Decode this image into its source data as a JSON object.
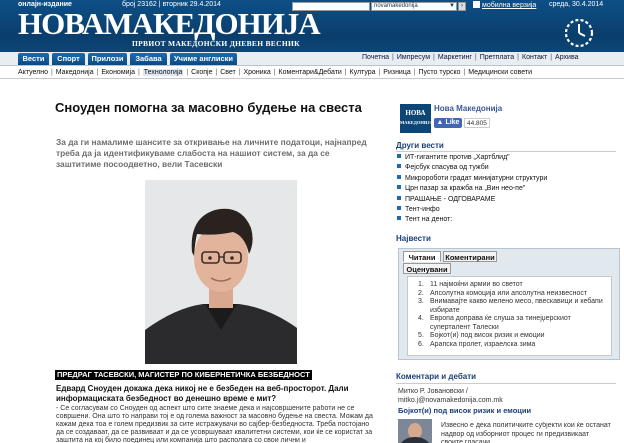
{
  "header": {
    "online_label": "онлајн-издание",
    "issue_info": "број 23162 | вторник 29.4.2014",
    "logo": "НОВАМАКЕДОНИЈА",
    "tagline": "ПРВИОТ МАКЕДОНСКИ ДНЕВЕН ВЕСНИК",
    "search_scope": "novamakedonija",
    "mobile_link": "мобилна верзија",
    "date": "среда, 30.4.2014"
  },
  "nav": {
    "tabs": [
      "Вести",
      "Спорт",
      "Прилози",
      "Забава",
      "Учиме англиски"
    ],
    "links": [
      "Почетна",
      "Импресум",
      "Маркетинг",
      "Претплата",
      "Контакт",
      "Архива"
    ]
  },
  "subnav": {
    "items": [
      "Актуелно",
      "Македонија",
      "Економија",
      "Технологија",
      "Скопје",
      "Свет",
      "Хроника",
      "Коментари&Дебати",
      "Култура",
      "Ризница",
      "Пусто турско",
      "Медицински совети"
    ],
    "active": "Технологија"
  },
  "article": {
    "title": "Сноуден помогна за масовно будење на свеста",
    "lead": "За да ги намалиме шансите за откривање на личните податоци, најнапред треба да ја идентификуваме слабоста на нашиот систем, за да се заштитиме посоодветно, вели Тасевски",
    "caption": "ПРЕДРАГ ТАСЕВСКИ, МАГИСТЕР ПО КИБЕРНЕТИЧКА БЕЗБЕДНОСТ",
    "subhead": "Едвард Сноуден докажа дека никој не е безбеден на веб-просторот. Дали информациската безбедност во денешно време е мит?",
    "body": "- Се согласувам со Сноуден од аспект што сите знаеме дека и најсовршените работи не се совршени. Она што то направи тој е од голема важност за масовно будење на свеста. Можам да кажам дека тоа е голем предизвик за сите истражувачи во сајбер-безбедноста. Треба постојано да се создаваат, да се развиваат и да се усовршуваат квалитетни системи, кои ќе се користат за заштита на кој било поединец или компанија што располага со свои лични и"
  },
  "sidebar": {
    "fb_logo_line1": "НОВА",
    "fb_logo_line2": "МАКЕДОНИЈА",
    "fb_name": "Нова Македонија",
    "fb_like": "Like",
    "fb_count": "44.805",
    "other_news_title": "Други вести",
    "other_news": [
      "ИТ-гигантите против „Хартблид\"",
      "Фејсбук спасува од тужби",
      "Микророботи градат минијатурни структури",
      "Црн пазар за кражба на „Вин нео-пе\"",
      "ПРАШАЊЕ - ОДГОВАРАМЕ",
      "Тент-инфо",
      "Тент на денот:"
    ],
    "latest_title": "Највести",
    "tabs": [
      "Читани",
      "Коментирани",
      "Оценувани"
    ],
    "popular": [
      "11 најмоќни армии во светот",
      "Апсолутна комоција или апсолутна неизвесност",
      "Внимавајте какво мелено месо, пвескавици и кебапи избирате",
      "Европа доправа ќе слуша за тинејџерскиот суперталент Талески",
      "Бојкот(и) под висок ризик и емоции",
      "Арапска пролет, израелска зима"
    ],
    "comments_title": "Коментари и дебати",
    "comment_author": "Митко Р. Јовановски /",
    "comment_email": "mitko.j@novamakedonija.com.mk",
    "comment_title": "Бојкот(и) под висок ризик и емоции",
    "comment_text": "Извесно е дека политичките субјекти кои ќе останат надвор од изборниот процес ги предизвикаат своите гласачи..."
  }
}
